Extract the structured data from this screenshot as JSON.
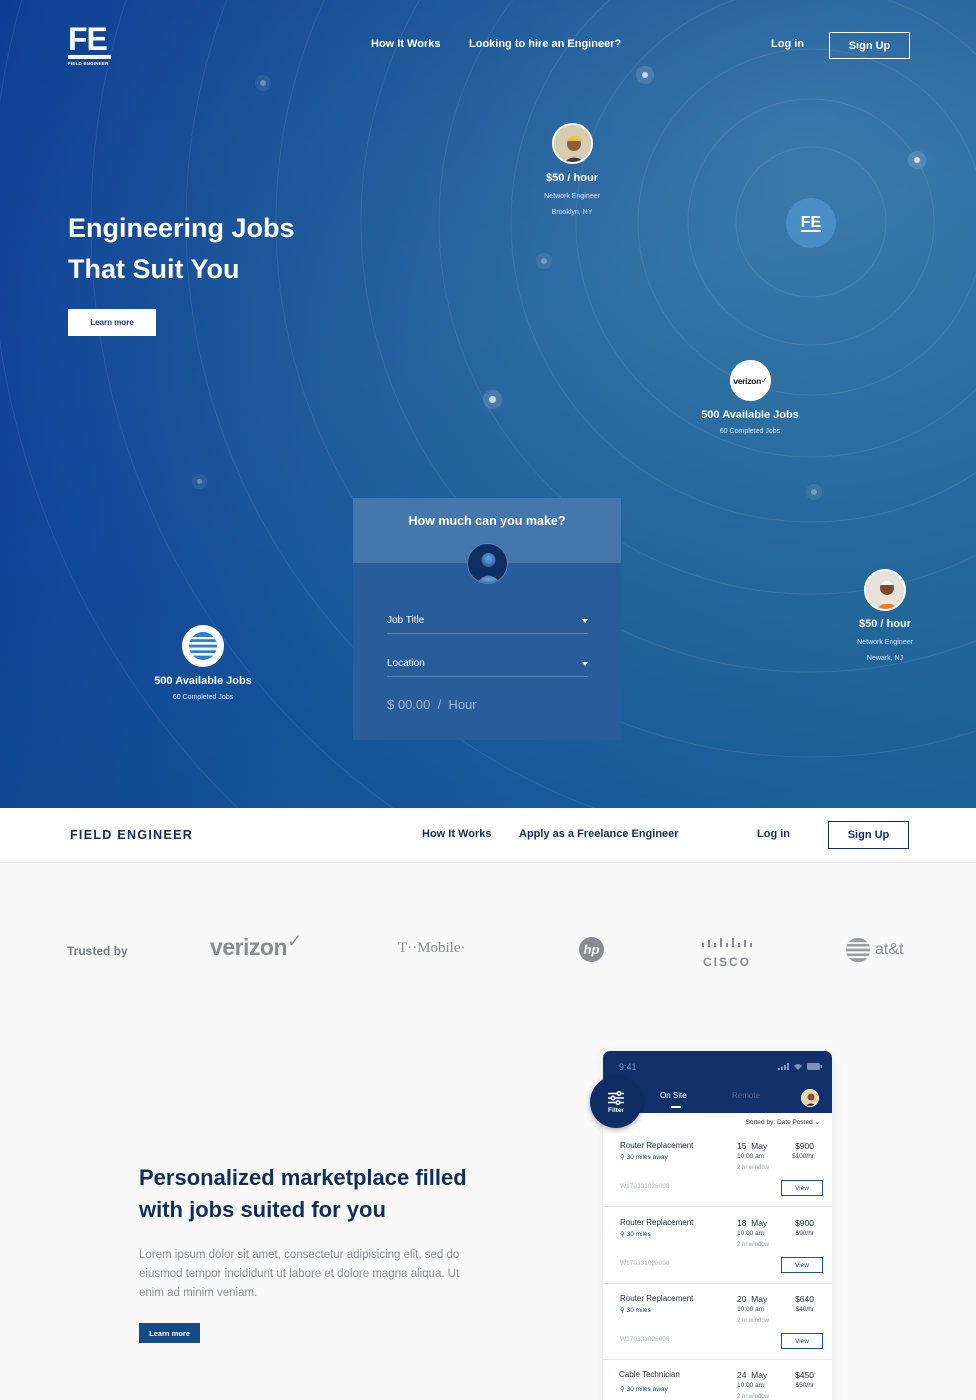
{
  "hero": {
    "logo": {
      "mark": "FE",
      "sub": "FIELD ENGINEER"
    },
    "nav": {
      "how": "How It Works",
      "hire": "Looking to hire an Engineer?",
      "login": "Log in",
      "signup": "Sign Up"
    },
    "title_line1": "Engineering Jobs",
    "title_line2": "That Suit You",
    "learn_more": "Learn more",
    "center_badge": "FE",
    "nodes": [
      {
        "rate": "$50 / hour",
        "role": "Network Engineer",
        "location": "Brooklyn, NY"
      },
      {
        "rate": "$50 / hour",
        "role": "Network Engineer",
        "location": "Newark, NJ"
      }
    ],
    "companies": [
      {
        "logo_text": "verizon",
        "jobs": "500 Available Jobs",
        "completed": "60 Completed Jobs"
      },
      {
        "jobs": "500 Available Jobs",
        "completed": "60 Completed Jobs"
      }
    ],
    "calculator": {
      "heading": "How much can you make?",
      "job_title": "Job Title",
      "location": "Location",
      "rate": "$ 00.00  /  Hour"
    }
  },
  "nav2": {
    "brand": "FIELD ENGINEER",
    "how": "How It Works",
    "apply": "Apply as a Freelance Engineer",
    "login": "Log in",
    "signup": "Sign Up"
  },
  "trusted": {
    "label": "Trusted by",
    "logos": [
      "verizon",
      "T··Mobile·",
      "hp",
      "CISCO",
      "at&t"
    ]
  },
  "marketplace": {
    "title": "Personalized marketplace filled with jobs suited for you",
    "body": "Lorem ipsum dolor sit amet, consectetur adipisicing elit, sed do eiusmod tempor incididunt ut labore et dolore magna aliqua. Ut enim ad minim veniam.",
    "learn_more": "Learn more"
  },
  "phone": {
    "time": "9:41",
    "filter": "Filter",
    "tabs": {
      "onsite": "On Site",
      "remote": "Remote"
    },
    "sorted": "Sorted by: Date Posted",
    "jobs": [
      {
        "title": "Router Replacement",
        "distance": "30 miles away",
        "date": "15  May",
        "time": "10:00 am",
        "window": "2 hr window",
        "price": "$900",
        "rate": "$100/hr",
        "id": "W170331028098",
        "view": "View"
      },
      {
        "title": "Router Replacement",
        "distance": "30 miles",
        "date": "18  May",
        "time": "10:00 am",
        "window": "2 hr window",
        "price": "$900",
        "rate": "$90/hr",
        "id": "W170331028098",
        "view": "View"
      },
      {
        "title": "Router Replacement",
        "distance": "30 miles",
        "date": "20  May",
        "time": "10:00 am",
        "window": "2 hr window",
        "price": "$640",
        "rate": "$40/hr",
        "id": "W170331028098",
        "view": "View"
      },
      {
        "title": "Cable Technician",
        "distance": "30 miles away",
        "date": "24  May",
        "time": "10:00 am",
        "window": "2 hr window",
        "price": "$450",
        "rate": "$50/hr",
        "id": "",
        "view": ""
      }
    ]
  },
  "colors": {
    "hero_dark": "#0b3a90",
    "hero_light": "#3e7dab",
    "navy": "#0f2d5e",
    "accent": "#154a88"
  }
}
